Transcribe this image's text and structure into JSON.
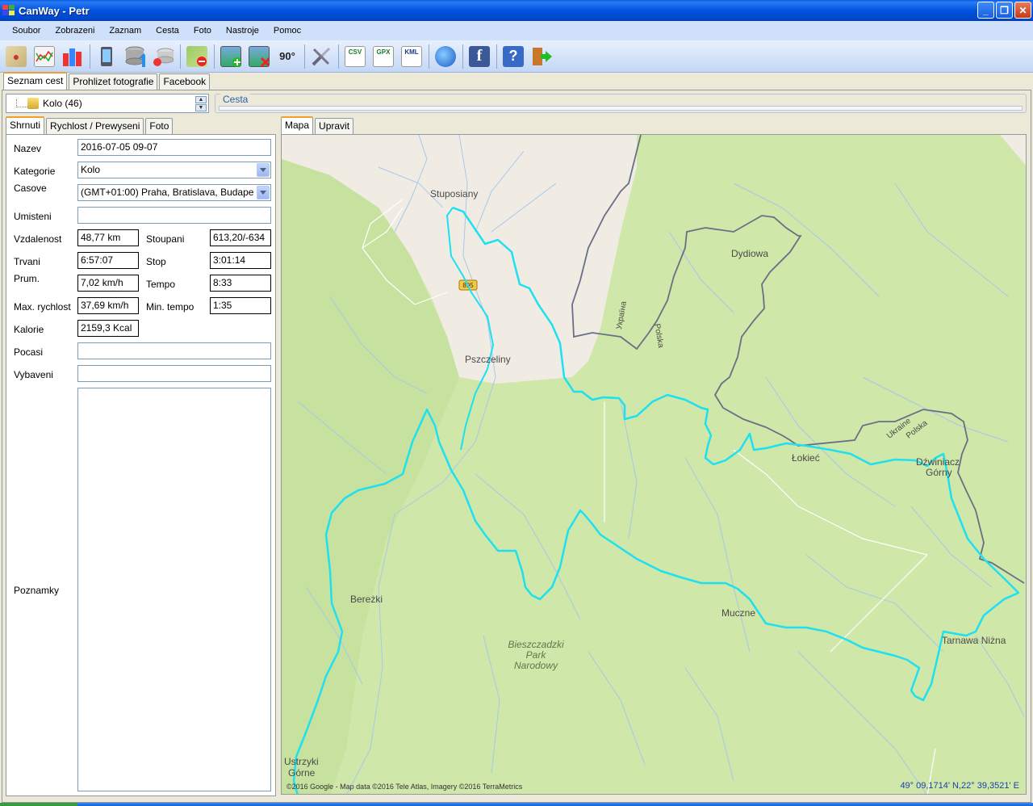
{
  "window": {
    "title": "CanWay - Petr"
  },
  "menu": [
    "Soubor",
    "Zobrazeni",
    "Zaznam",
    "Cesta",
    "Foto",
    "Nastroje",
    "Pomoc"
  ],
  "toolbar": {
    "icons": [
      "map-icon",
      "chart-icon",
      "bar-chart-icon",
      "phone-icon",
      "database-upload-icon",
      "database-icon",
      "map-remove-icon",
      "photo-add-icon",
      "photo-remove-icon",
      "rotate-90-icon",
      "tools-icon",
      "csv-export-icon",
      "gpx-export-icon",
      "kml-export-icon",
      "google-earth-icon",
      "facebook-icon",
      "help-icon",
      "exit-icon"
    ],
    "rotate_label": "90°",
    "csv_label": "CSV",
    "gpx_label": "GPX",
    "kml_label": "KML",
    "fb_label": "f",
    "help_label": "?"
  },
  "top_tabs": [
    "Seznam cest",
    "Prohlizet fotografie",
    "Facebook"
  ],
  "category": {
    "label": "Kolo (46)"
  },
  "cesta_group": {
    "legend": "Cesta"
  },
  "left_tabs": [
    "Shrnuti",
    "Rychlost / Prewyseni",
    "Foto"
  ],
  "summary": {
    "nazev_label": "Nazev",
    "nazev": "2016-07-05 09-07",
    "kategorie_label": "Kategorie",
    "kategorie": "Kolo",
    "casove_label": "Casove",
    "casove": "(GMT+01:00) Praha, Bratislava, Budape",
    "umisteni_label": "Umisteni",
    "umisteni": "",
    "vzdalenost_label": "Vzdalenost",
    "vzdalenost": "48,77 km",
    "stoupani_label": "Stoupani",
    "stoupani": "613,20/-634",
    "trvani_label": "Trvani",
    "trvani": "6:57:07",
    "stop_label": "Stop",
    "stop": "3:01:14",
    "prum_label": "Prum.",
    "prum": "7,02 km/h",
    "tempo_label": "Tempo",
    "tempo": "8:33",
    "max_rychlost_label": "Max. rychlost",
    "max_rychlost": "37,69 km/h",
    "min_tempo_label": "Min. tempo",
    "min_tempo": "1:35",
    "kalorie_label": "Kalorie",
    "kalorie": "2159,3 Kcal",
    "pocasi_label": "Pocasi",
    "pocasi": "",
    "vybaveni_label": "Vybaveni",
    "vybaveni": "",
    "poznamky_label": "Poznamky",
    "poznamky": ""
  },
  "right_tabs": [
    "Mapa",
    "Upravit"
  ],
  "map": {
    "places": [
      "Stuposiany",
      "Dydiowa",
      "Pszczeliny",
      "Łokieć",
      "Dźwiniacz",
      "Górny",
      "Bereżki",
      "Muczne",
      "Tarnawa Niżna",
      "Ustrzyki",
      "Górne",
      "Bieszczadzki",
      "Park",
      "Narodowy"
    ],
    "road_number": "895",
    "border_labels": [
      "Україна",
      "Polska",
      "Ukraine",
      "Polska"
    ],
    "copyright": "©2016 Google - Map data ©2016 Tele Atlas, Imagery ©2016 TerraMetrics",
    "coordinates": "49° 09,1714' N,22° 39,3521' E",
    "route_color": "#1ee0f0"
  }
}
